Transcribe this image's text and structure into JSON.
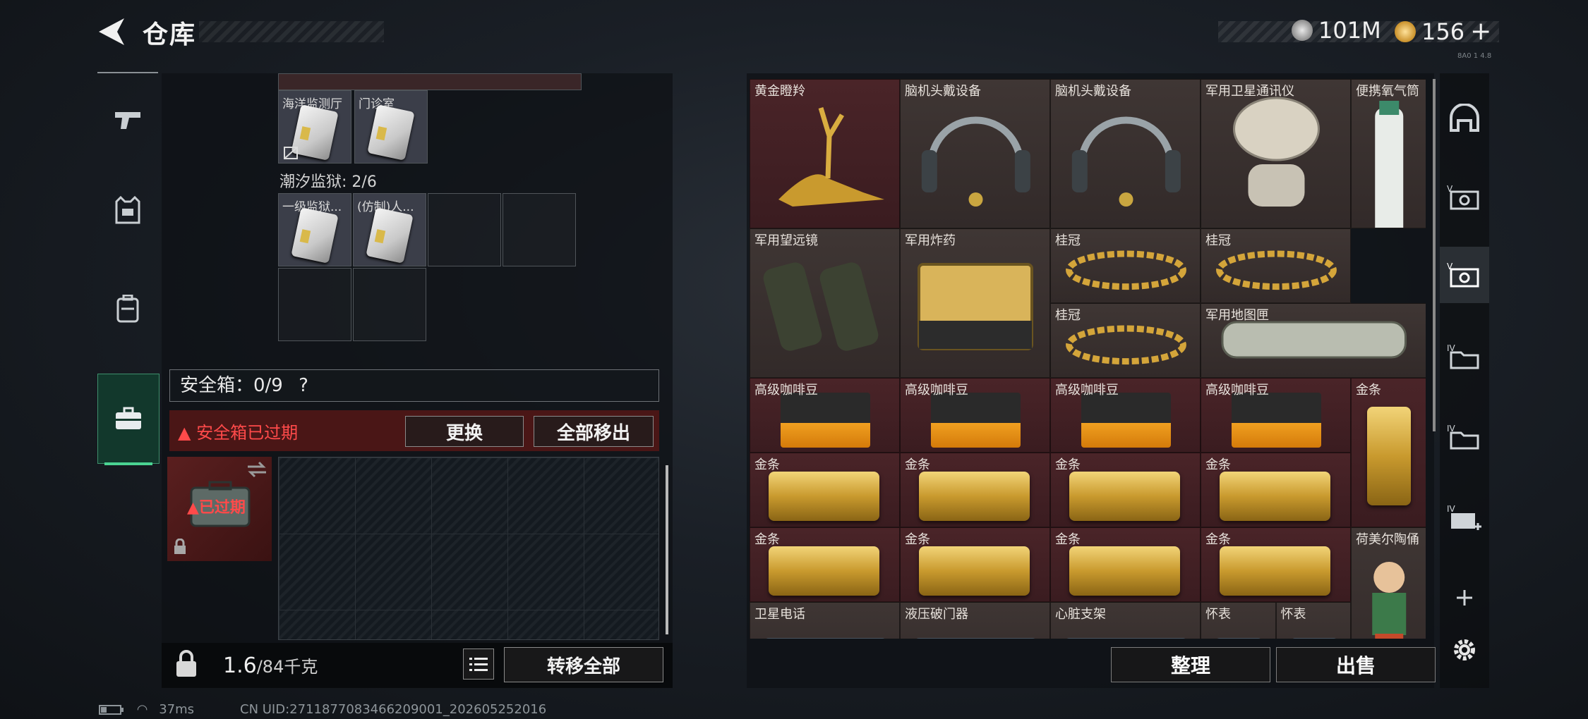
{
  "header": {
    "title": "仓库",
    "currency1": "101M",
    "currency2": "156",
    "currency2_plus": "+",
    "version": "8A0 1 4.8"
  },
  "left_nav": [
    {
      "icon": "pistol-icon"
    },
    {
      "icon": "vest-icon"
    },
    {
      "icon": "backpack-icon"
    },
    {
      "icon": "safe-case-icon"
    }
  ],
  "left": {
    "keys_top": [
      {
        "label": "海洋监测厅"
      },
      {
        "label": "门诊室"
      }
    ],
    "prison_title": "潮汐监狱: 2/6",
    "keys_prison": [
      {
        "label": "一级监狱..."
      },
      {
        "label": "(仿制)人..."
      }
    ],
    "safe_box": "安全箱：0/9",
    "safe_help": "?",
    "expired_warning": "安全箱已过期",
    "btn_replace": "更换",
    "btn_move_all_out": "全部移出",
    "case_expired": "已过期",
    "weight_value": "1.6",
    "weight_max": "/84千克",
    "btn_transfer_all": "转移全部"
  },
  "right": {
    "items": [
      {
        "label": "黄金瞪羚",
        "kind": "gazelle"
      },
      {
        "label": "脑机头戴设备",
        "kind": "headset"
      },
      {
        "label": "脑机头戴设备",
        "kind": "headset"
      },
      {
        "label": "军用卫星通讯仪",
        "kind": "dish"
      },
      {
        "label": "便携氧气筒",
        "kind": "oxygen"
      },
      {
        "label": "军用望远镜",
        "kind": "binoculars"
      },
      {
        "label": "军用炸药",
        "kind": "explosive"
      },
      {
        "label": "桂冠",
        "kind": "laurel"
      },
      {
        "label": "桂冠",
        "kind": "laurel"
      },
      {
        "label": "桂冠",
        "kind": "laurel"
      },
      {
        "label": "军用地图匣",
        "kind": "tube"
      },
      {
        "label": "高级咖啡豆",
        "kind": "coffee"
      },
      {
        "label": "高级咖啡豆",
        "kind": "coffee"
      },
      {
        "label": "高级咖啡豆",
        "kind": "coffee"
      },
      {
        "label": "高级咖啡豆",
        "kind": "coffee"
      },
      {
        "label": "金条",
        "kind": "goldv"
      },
      {
        "label": "金条",
        "kind": "gold"
      },
      {
        "label": "金条",
        "kind": "gold"
      },
      {
        "label": "金条",
        "kind": "gold"
      },
      {
        "label": "金条",
        "kind": "gold"
      },
      {
        "label": "金条",
        "kind": "gold"
      },
      {
        "label": "金条",
        "kind": "gold"
      },
      {
        "label": "金条",
        "kind": "gold"
      },
      {
        "label": "金条",
        "kind": "gold"
      },
      {
        "label": "荷美尔陶俑",
        "kind": "figurine"
      },
      {
        "label": "卫星电话",
        "kind": "phone"
      },
      {
        "label": "液压破门器",
        "kind": "breacher"
      },
      {
        "label": "心脏支架",
        "kind": "stent"
      },
      {
        "label": "怀表",
        "kind": "watch"
      },
      {
        "label": "怀表",
        "kind": "watch"
      }
    ],
    "btn_sort": "整理",
    "btn_sell": "出售"
  },
  "right_nav": [
    {
      "icon": "helmet-icon"
    },
    {
      "icon": "storage-v-icon"
    },
    {
      "icon": "storage-v-active-icon"
    },
    {
      "icon": "storage-iv-icon"
    },
    {
      "icon": "storage-iv-2-icon"
    },
    {
      "icon": "storage-iv-add-icon"
    },
    {
      "icon": "plus-icon"
    },
    {
      "icon": "gear-icon"
    }
  ],
  "status": {
    "ping": "37ms",
    "uid": "CN UID:2711877083466209001_202605252016"
  },
  "colors": {
    "red_cell": "#4a2428",
    "brown_cell": "#3f3634",
    "warning": "#ff4a4a",
    "active_green": "#4ad392",
    "gold": "#d4a53a"
  }
}
